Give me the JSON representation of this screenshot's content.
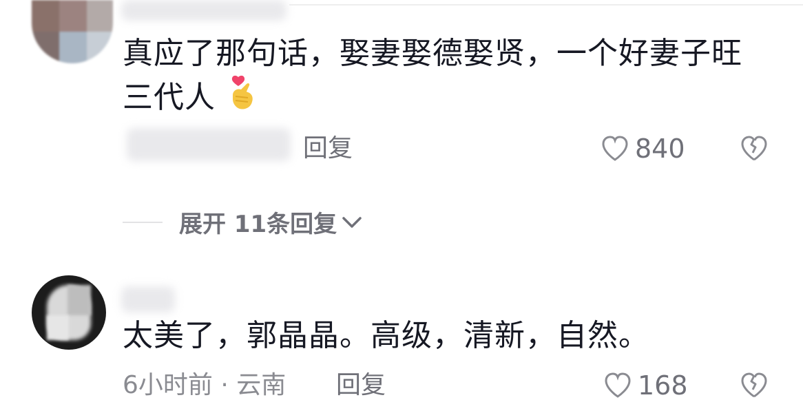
{
  "comments": [
    {
      "text_line1": "真应了那句话，娶妻娶德娶贤，一个好妻子旺",
      "text_line2": "三代人",
      "reply_label": "回复",
      "like_count": "840"
    },
    {
      "text": "太美了，郭晶晶。高级，清新，自然。",
      "meta": "6小时前 · 云南",
      "reply_label": "回复",
      "like_count": "168"
    }
  ],
  "expand_replies_label": "展开 11条回复",
  "icons": {
    "like": "heart-outline-icon",
    "dislike": "broken-heart-icon",
    "expand": "chevron-down-icon",
    "emoji": "finger-heart-emoji"
  },
  "colors": {
    "text": "#161823",
    "secondary": "#6f7078",
    "divider": "#e3e3e5"
  }
}
